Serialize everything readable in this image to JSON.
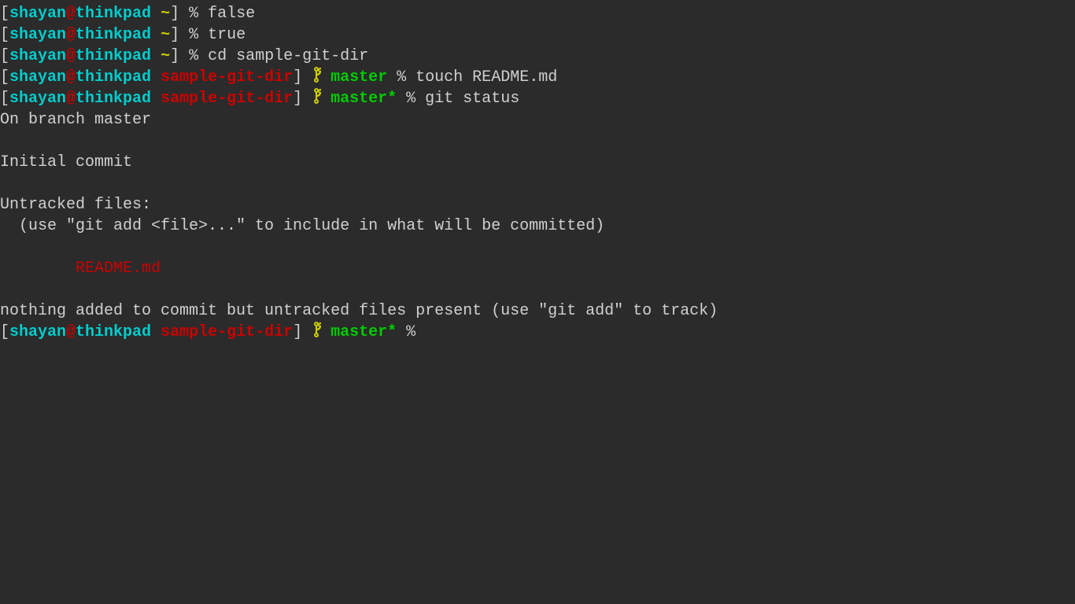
{
  "colors": {
    "bg": "#2b2b2b",
    "text": "#d0d0d0",
    "cyan": "#00cccc",
    "red": "#cc0000",
    "yellow": "#cccc00",
    "green": "#00cc00"
  },
  "user": "shayan",
  "at": "@",
  "host": "thinkpad",
  "home_dir": "~",
  "git_dir": "sample-git-dir",
  "percent": " % ",
  "space": " ",
  "branch": "master",
  "branch_dirty": "master*",
  "cmd_false": "false",
  "cmd_true": "true",
  "cmd_cd": "cd sample-git-dir",
  "cmd_touch": "touch README.md",
  "cmd_git_status": "git status",
  "out_branch": "On branch master",
  "out_blank": " ",
  "out_initial": "Initial commit",
  "out_untracked": "Untracked files:",
  "out_hint": "  (use \"git add <file>...\" to include in what will be committed)",
  "out_file_indent": "        ",
  "out_file": "README.md",
  "out_nothing": "nothing added to commit but untracked files present (use \"git add\" to track)",
  "lbracket": "[",
  "rbracket": "]",
  "rbracket_sp": "] "
}
